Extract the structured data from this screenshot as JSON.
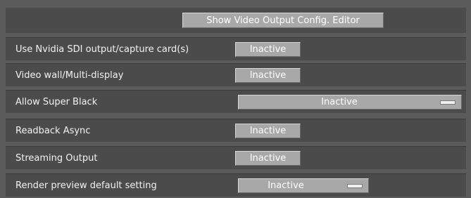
{
  "header": {
    "show_editor_label": "Show Video Output Config. Editor"
  },
  "settings": [
    {
      "label": "Use Nvidia SDI output/capture card(s)",
      "value": "Inactive",
      "control": "toggle"
    },
    {
      "label": "Video wall/Multi-display",
      "value": "Inactive",
      "control": "toggle"
    },
    {
      "label": "Allow Super Black",
      "value": "Inactive",
      "control": "dropdown"
    },
    {
      "label": "Readback Async",
      "value": "Inactive",
      "control": "toggle"
    },
    {
      "label": "Streaming Output",
      "value": "Inactive",
      "control": "toggle"
    },
    {
      "label": "Render preview default setting",
      "value": "Inactive",
      "control": "dropdown"
    }
  ],
  "colors": {
    "panel_bg": "#5b5b5b",
    "row_bg": "#4b4b4b",
    "button_bg": "#a8a8a8",
    "text": "#ffffff"
  }
}
